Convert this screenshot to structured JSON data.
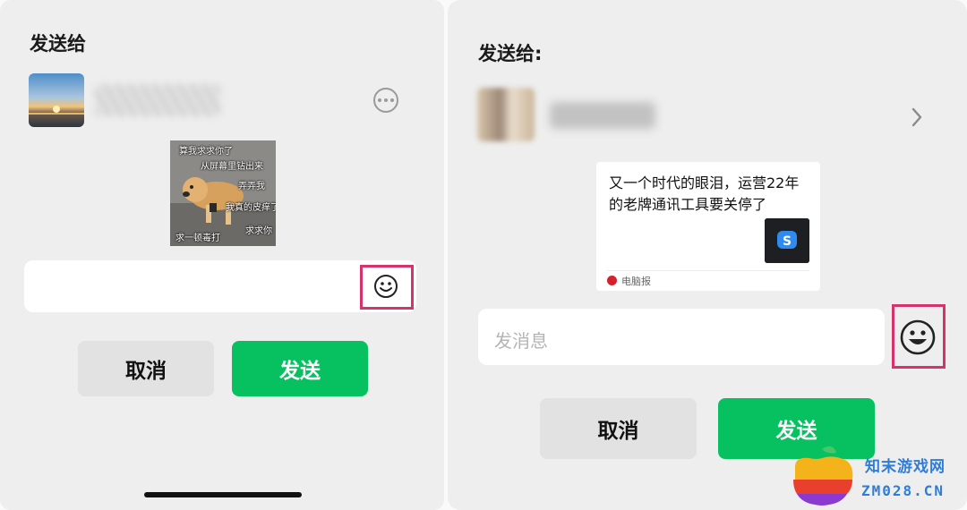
{
  "left": {
    "title": "发送给",
    "meme": {
      "captions": [
        "算我求求你了",
        "从屏幕里钻出来",
        "弄弄我",
        "我真的皮痒了",
        "求一顿毒打",
        "求求你"
      ]
    },
    "cancel_label": "取消",
    "send_label": "发送"
  },
  "right": {
    "title": "发送给:",
    "card": {
      "title": "又一个时代的眼泪，运营22年的老牌通讯工具要关停了",
      "source": "电脑报"
    },
    "input_placeholder": "发消息",
    "cancel_label": "取消",
    "send_label": "发送"
  },
  "watermark": {
    "name_cn": "知末游戏网",
    "domain": "ZM028.CN"
  },
  "colors": {
    "send_green": "#07c160",
    "highlight": "#d6336c",
    "panel_bg": "#eeeeee"
  },
  "icons": [
    "more-icon",
    "emoji-smiley-icon",
    "chevron-right-icon",
    "skype-icon"
  ]
}
